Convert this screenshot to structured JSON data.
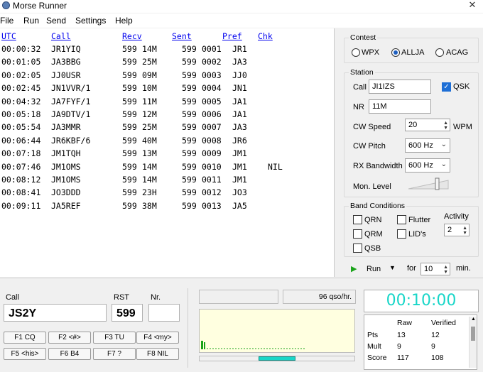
{
  "window": {
    "title": "Morse Runner",
    "close_glyph": "✕"
  },
  "menu": [
    "File",
    "Run",
    "Send",
    "Settings",
    "Help"
  ],
  "log": {
    "headers": [
      "UTC",
      "Call",
      "Recv",
      "Sent",
      "Pref",
      "Chk"
    ],
    "rows": [
      {
        "utc": "00:00:32",
        "call": "JR1YIQ",
        "rst": "599",
        "recv_nr": "14M",
        "rst_sent": "599",
        "sent_nr": "0001",
        "pref": "JR1",
        "chk": ""
      },
      {
        "utc": "00:01:05",
        "call": "JA3BBG",
        "rst": "599",
        "recv_nr": "25M",
        "rst_sent": "599",
        "sent_nr": "0002",
        "pref": "JA3",
        "chk": ""
      },
      {
        "utc": "00:02:05",
        "call": "JJ0USR",
        "rst": "599",
        "recv_nr": "09M",
        "rst_sent": "599",
        "sent_nr": "0003",
        "pref": "JJ0",
        "chk": ""
      },
      {
        "utc": "00:02:45",
        "call": "JN1VVR/1",
        "rst": "599",
        "recv_nr": "10M",
        "rst_sent": "599",
        "sent_nr": "0004",
        "pref": "JN1",
        "chk": ""
      },
      {
        "utc": "00:04:32",
        "call": "JA7FYF/1",
        "rst": "599",
        "recv_nr": "11M",
        "rst_sent": "599",
        "sent_nr": "0005",
        "pref": "JA1",
        "chk": ""
      },
      {
        "utc": "00:05:18",
        "call": "JA9DTV/1",
        "rst": "599",
        "recv_nr": "12M",
        "rst_sent": "599",
        "sent_nr": "0006",
        "pref": "JA1",
        "chk": ""
      },
      {
        "utc": "00:05:54",
        "call": "JA3MMR",
        "rst": "599",
        "recv_nr": "25M",
        "rst_sent": "599",
        "sent_nr": "0007",
        "pref": "JA3",
        "chk": ""
      },
      {
        "utc": "00:06:44",
        "call": "JR6KBF/6",
        "rst": "599",
        "recv_nr": "40M",
        "rst_sent": "599",
        "sent_nr": "0008",
        "pref": "JR6",
        "chk": ""
      },
      {
        "utc": "00:07:18",
        "call": "JM1TQH",
        "rst": "599",
        "recv_nr": "13M",
        "rst_sent": "599",
        "sent_nr": "0009",
        "pref": "JM1",
        "chk": ""
      },
      {
        "utc": "00:07:46",
        "call": "JM1OMS",
        "rst": "599",
        "recv_nr": "14M",
        "rst_sent": "599",
        "sent_nr": "0010",
        "pref": "JM1",
        "chk": "NIL"
      },
      {
        "utc": "00:08:12",
        "call": "JM1OMS",
        "rst": "599",
        "recv_nr": "14M",
        "rst_sent": "599",
        "sent_nr": "0011",
        "pref": "JM1",
        "chk": ""
      },
      {
        "utc": "00:08:41",
        "call": "JO3DDD",
        "rst": "599",
        "recv_nr": "23H",
        "rst_sent": "599",
        "sent_nr": "0012",
        "pref": "JO3",
        "chk": ""
      },
      {
        "utc": "00:09:11",
        "call": "JA5REF",
        "rst": "599",
        "recv_nr": "38M",
        "rst_sent": "599",
        "sent_nr": "0013",
        "pref": "JA5",
        "chk": ""
      }
    ]
  },
  "contest": {
    "title": "Contest",
    "options": [
      {
        "label": "WPX",
        "selected": false
      },
      {
        "label": "ALLJA",
        "selected": true
      },
      {
        "label": "ACAG",
        "selected": false
      }
    ]
  },
  "station": {
    "title": "Station",
    "call_label": "Call",
    "call_value": "JI1IZS",
    "qsk_label": "QSK",
    "qsk_checked": true,
    "nr_label": "NR",
    "nr_value": "11M",
    "cw_speed_label": "CW Speed",
    "cw_speed_value": "20",
    "wpm_label": "WPM",
    "cw_pitch_label": "CW Pitch",
    "cw_pitch_value": "600 Hz",
    "rx_bw_label": "RX Bandwidth",
    "rx_bw_value": "600 Hz",
    "mon_level_label": "Mon. Level",
    "mon_level_fraction": 0.75
  },
  "band": {
    "title": "Band Conditions",
    "qrn": "QRN",
    "qrm": "QRM",
    "qsb": "QSB",
    "flutter": "Flutter",
    "lids": "LID's",
    "activity_label": "Activity",
    "activity_value": "2"
  },
  "run": {
    "label": "Run",
    "for_label": "for",
    "minutes": "10",
    "min_label": "min."
  },
  "entry": {
    "call_label": "Call",
    "call_value": "JS2Y",
    "rst_label": "RST",
    "rst_value": "599",
    "nr_label": "Nr.",
    "nr_value": ""
  },
  "fkeys": [
    "F1 CQ",
    "F2 <#>",
    "F3 TU",
    "F4 <my>",
    "F5 <his>",
    "F6 B4",
    "F7 ?",
    "F8 NIL"
  ],
  "rate": {
    "text": "96 qso/hr."
  },
  "clock": {
    "time": "00:10:00"
  },
  "score": {
    "col_raw": "Raw",
    "col_verified": "Verified",
    "rows": [
      {
        "label": "Pts",
        "raw": "13",
        "verified": "12"
      },
      {
        "label": "Mult",
        "raw": "9",
        "verified": "9"
      },
      {
        "label": "Score",
        "raw": "117",
        "verified": "108"
      }
    ]
  },
  "colors": {
    "accent": "#1e6fd6",
    "clock": "#19d6c8",
    "run_triangle": "#1aa31a",
    "link": "#0000ee"
  }
}
